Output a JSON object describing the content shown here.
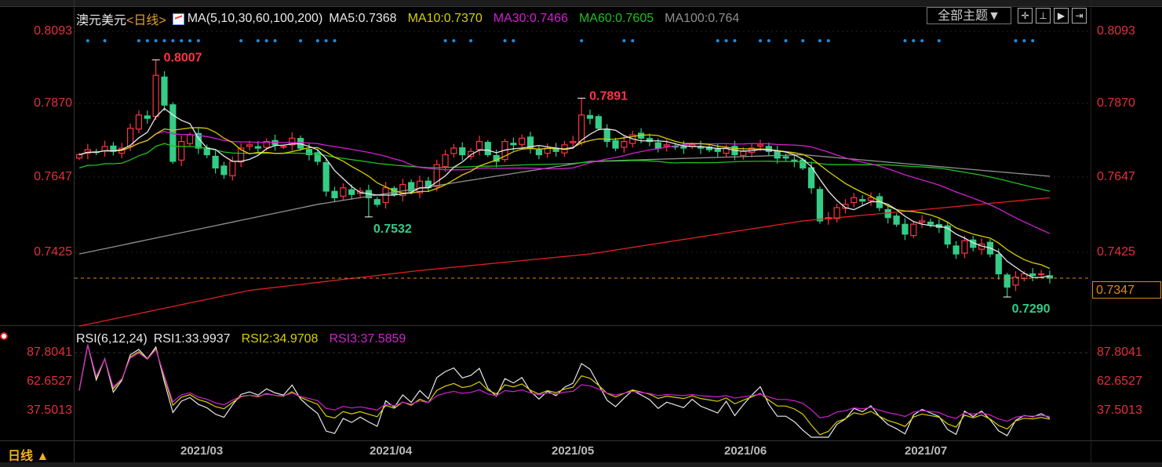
{
  "header": {
    "symbol": "澳元美元",
    "period_tag": "<日线>",
    "ma_label": "MA(5,10,30,60,100,200)",
    "ma5": "MA5:0.7368",
    "ma10": "MA10:0.7370",
    "ma30": "MA30:0.7466",
    "ma60": "MA60:0.7605",
    "ma100": "MA100:0.764",
    "theme_button": "全部主题▼"
  },
  "colors": {
    "up": "#ff3344",
    "down": "#35cc87",
    "ma5": "#e8e8e8",
    "ma10": "#d8d000",
    "ma30": "#d020d0",
    "ma60": "#20c020",
    "ma100": "#909090",
    "ma200": "#e02020",
    "last": "#e08a1a",
    "dots": "#1a8fe0"
  },
  "price_axis": {
    "labels": [
      "0.8093",
      "0.7870",
      "0.7647",
      "0.7425"
    ],
    "left_labels": [
      "0.8093",
      "0.7870",
      "0.7647",
      "0.7425"
    ],
    "last_price": "0.7347"
  },
  "annotations": [
    {
      "text": "0.8007",
      "index": 9,
      "price": 0.8007,
      "type": "high"
    },
    {
      "text": "0.7891",
      "index": 59,
      "price": 0.7891,
      "type": "high"
    },
    {
      "text": "0.7532",
      "index": 34,
      "price": 0.7532,
      "type": "low"
    },
    {
      "text": "0.7290",
      "index": 109,
      "price": 0.729,
      "type": "low"
    }
  ],
  "rsi": {
    "label": "RSI(6,12,24)",
    "rsi1": "RSI1:33.9937",
    "rsi2": "RSI2:34.9708",
    "rsi3": "RSI3:37.5859",
    "axis": [
      "87.8041",
      "62.6527",
      "37.5013"
    ]
  },
  "dates": [
    "2021/03",
    "2021/04",
    "2021/05",
    "2021/06",
    "2021/07"
  ],
  "footer": {
    "period": "日线 ▲"
  },
  "chart_data": {
    "type": "candlestick",
    "closes": [
      0.772,
      0.7735,
      0.7728,
      0.7745,
      0.773,
      0.774,
      0.78,
      0.784,
      0.783,
      0.796,
      0.787,
      0.77,
      0.776,
      0.778,
      0.774,
      0.772,
      0.768,
      0.766,
      0.77,
      0.774,
      0.775,
      0.774,
      0.776,
      0.775,
      0.7745,
      0.777,
      0.774,
      0.772,
      0.77,
      0.761,
      0.759,
      0.762,
      0.76,
      0.761,
      0.759,
      0.757,
      0.762,
      0.76,
      0.763,
      0.761,
      0.764,
      0.762,
      0.769,
      0.772,
      0.774,
      0.772,
      0.773,
      0.776,
      0.772,
      0.77,
      0.776,
      0.775,
      0.777,
      0.774,
      0.772,
      0.774,
      0.773,
      0.775,
      0.776,
      0.784,
      0.783,
      0.78,
      0.776,
      0.774,
      0.776,
      0.778,
      0.777,
      0.776,
      0.774,
      0.775,
      0.7745,
      0.774,
      0.775,
      0.774,
      0.7735,
      0.773,
      0.774,
      0.772,
      0.773,
      0.774,
      0.775,
      0.773,
      0.771,
      0.771,
      0.77,
      0.768,
      0.762,
      0.752,
      0.753,
      0.756,
      0.757,
      0.759,
      0.758,
      0.759,
      0.756,
      0.753,
      0.751,
      0.748,
      0.751,
      0.752,
      0.751,
      0.75,
      0.745,
      0.742,
      0.746,
      0.744,
      0.745,
      0.742,
      0.736,
      0.732,
      0.735,
      0.736,
      0.7355,
      0.736,
      0.7347
    ],
    "ma100_path": [
      [
        0,
        0.742
      ],
      [
        28,
        0.757
      ],
      [
        60,
        0.77
      ],
      [
        85,
        0.772
      ],
      [
        114,
        0.7655
      ]
    ],
    "ma200_path": [
      [
        0,
        0.7202
      ],
      [
        20,
        0.731
      ],
      [
        40,
        0.737
      ],
      [
        60,
        0.742
      ],
      [
        85,
        0.752
      ],
      [
        114,
        0.759
      ]
    ],
    "signal_dots": [
      1,
      3,
      7,
      8,
      9,
      10,
      11,
      12,
      13,
      14,
      19,
      21,
      22,
      23,
      26,
      28,
      29,
      30,
      43,
      44,
      46,
      50,
      51,
      59,
      64,
      65,
      75,
      76,
      77,
      80,
      81,
      83,
      85,
      87,
      88,
      97,
      98,
      99,
      101,
      110,
      111,
      112
    ],
    "y_range": [
      0.7202,
      0.8093
    ],
    "rsi_axis": [
      37.5013,
      62.6527,
      87.8041
    ]
  }
}
